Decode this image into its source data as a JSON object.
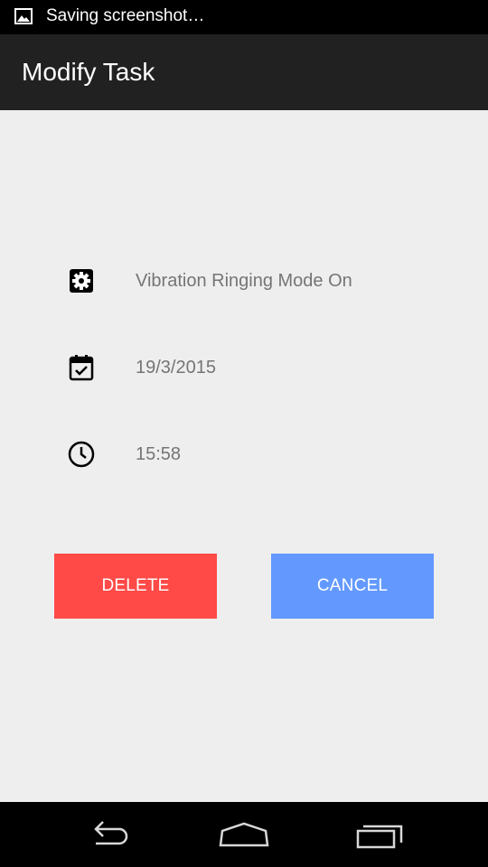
{
  "status_bar": {
    "notification_icon": "image-icon",
    "text": "Saving screenshot…"
  },
  "app_bar": {
    "title": "Modify Task"
  },
  "task": {
    "mode": {
      "icon": "settings-icon",
      "label": "Vibration Ringing Mode On"
    },
    "date": {
      "icon": "calendar-check-icon",
      "label": "19/3/2015"
    },
    "time": {
      "icon": "clock-icon",
      "label": "15:58"
    }
  },
  "buttons": {
    "delete": {
      "label": "DELETE",
      "color": "#ff4a47"
    },
    "cancel": {
      "label": "CANCEL",
      "color": "#6399ff"
    }
  },
  "nav_bar": {
    "back_icon": "back-icon",
    "home_icon": "home-icon",
    "recents_icon": "recents-icon"
  }
}
